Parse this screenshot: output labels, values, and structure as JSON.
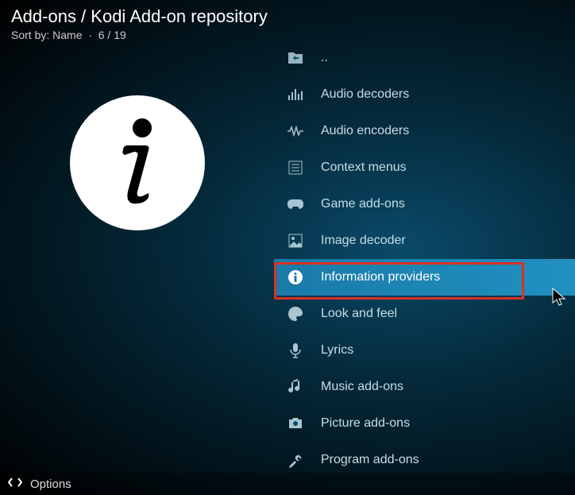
{
  "header": {
    "breadcrumb": "Add-ons / Kodi Add-on repository",
    "sort_label": "Sort by:",
    "sort_value": "Name",
    "position": "6 / 19"
  },
  "items": [
    {
      "label": "..",
      "icon": "folder-back-icon"
    },
    {
      "label": "Audio decoders",
      "icon": "equalizer-icon"
    },
    {
      "label": "Audio encoders",
      "icon": "waveform-icon"
    },
    {
      "label": "Context menus",
      "icon": "menu-list-icon"
    },
    {
      "label": "Game add-ons",
      "icon": "gamepad-icon"
    },
    {
      "label": "Image decoder",
      "icon": "image-frame-icon"
    },
    {
      "label": "Information providers",
      "icon": "info-circle-icon",
      "selected": true
    },
    {
      "label": "Look and feel",
      "icon": "palette-icon"
    },
    {
      "label": "Lyrics",
      "icon": "microphone-icon"
    },
    {
      "label": "Music add-ons",
      "icon": "music-note-icon"
    },
    {
      "label": "Picture add-ons",
      "icon": "camera-icon"
    },
    {
      "label": "Program add-ons",
      "icon": "tools-icon"
    }
  ],
  "footer": {
    "options_label": "Options"
  }
}
